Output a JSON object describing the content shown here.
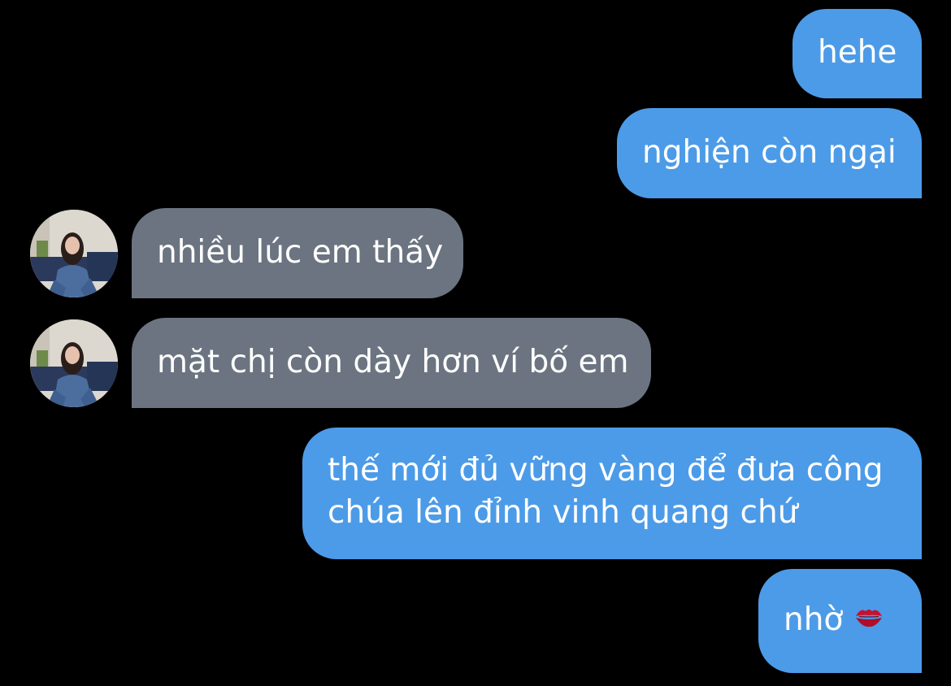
{
  "conversation": {
    "messages": [
      {
        "sender": "me",
        "text": "hehe"
      },
      {
        "sender": "me",
        "text": "nghiện còn ngại"
      },
      {
        "sender": "contact",
        "text": "nhiều lúc em thấy"
      },
      {
        "sender": "contact",
        "text": "mặt chị còn dày hơn ví bố em"
      },
      {
        "sender": "me",
        "lines": [
          "thế mới đủ vững vàng để đưa công",
          "chúa lên đỉnh vinh quang chứ"
        ]
      },
      {
        "sender": "me",
        "text": "nhờ",
        "emoji": "kiss-mark-icon"
      }
    ]
  },
  "colors": {
    "background": "#000000",
    "outgoing_bubble": "#4c9be8",
    "incoming_bubble": "#6b7480",
    "text": "#ffffff"
  }
}
